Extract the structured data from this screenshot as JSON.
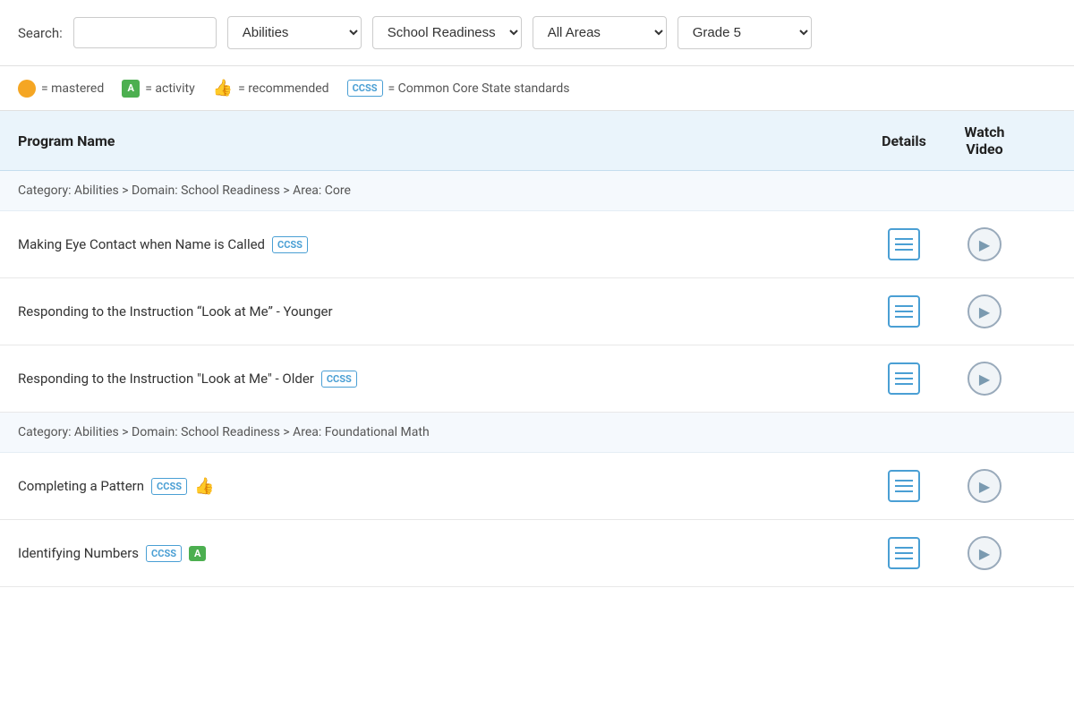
{
  "search": {
    "label": "Search:",
    "placeholder": "",
    "filter1": "Abilities",
    "filter2": "School Readiness",
    "filter3": "All Areas",
    "filter4": "Grade 5"
  },
  "legend": {
    "mastered_label": "= mastered",
    "activity_symbol": "A",
    "activity_label": "= activity",
    "recommended_label": "= recommended",
    "ccss_label": "CCSS",
    "ccss_full_label": "= Common Core State standards"
  },
  "table": {
    "col_program": "Program Name",
    "col_details": "Details",
    "col_watch_video": "Watch Video"
  },
  "categories": [
    {
      "label": "Category: Abilities  >  Domain: School Readiness  >  Area: Core",
      "programs": [
        {
          "name": "Making Eye Contact when Name is Called",
          "ccss": true,
          "activity": false,
          "recommended": false
        },
        {
          "name": "Responding to the Instruction “Look at Me” - Younger",
          "ccss": false,
          "activity": false,
          "recommended": false
        },
        {
          "name": "Responding to the Instruction \"Look at Me\" - Older",
          "ccss": true,
          "activity": false,
          "recommended": false
        }
      ]
    },
    {
      "label": "Category: Abilities  >  Domain: School Readiness  >  Area: Foundational Math",
      "programs": [
        {
          "name": "Completing a Pattern",
          "ccss": true,
          "activity": false,
          "recommended": true
        },
        {
          "name": "Identifying Numbers",
          "ccss": true,
          "activity": true,
          "recommended": false
        }
      ]
    }
  ],
  "badges": {
    "ccss": "CCSS",
    "activity": "A"
  }
}
